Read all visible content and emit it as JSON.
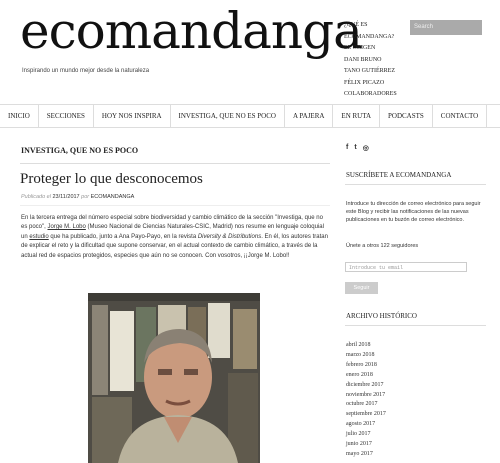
{
  "header": {
    "site_title": "ecomandanga",
    "tagline": "Inspirando un mundo mejor desde la naturaleza",
    "top_links": [
      "¿QUÉ ES ECOMANDANGA?",
      "EL ORIGEN",
      "DANI BRUNO",
      "TANO GUTIÉRREZ",
      "FÉLIX PICAZO",
      "COLABORADORES"
    ],
    "search_placeholder": "Search"
  },
  "nav": {
    "items": [
      "INICIO",
      "SECCIONES",
      "HOY NOS INSPIRA",
      "INVESTIGA, QUE NO ES POCO",
      "A PAJERA",
      "EN RUTA",
      "PODCASTS",
      "CONTACTO"
    ]
  },
  "main": {
    "category_title": "INVESTIGA, QUE NO ES POCO",
    "post": {
      "title": "Proteger lo que desconocemos",
      "published_prefix": "Publicado el",
      "date": "23/11/2017",
      "by": "por",
      "author": "ECOMANDANGA",
      "body_1": "En la tercera entrega del número especial sobre biodiversidad y cambio climático de la sección \"Investiga, que no es poco\",",
      "body_link_1": "Jorge M. Lobo",
      "body_2": "(Museo Nacional de Ciencias Naturales-CSIC, Madrid) nos resume en lenguaje coloquial un",
      "body_link_2": "estudio",
      "body_3": "que ha publicado, junto a Ana Payo-Payo, en la revista",
      "body_journal": "Diversity & Distributions",
      "body_4": ". En él, los autores tratan de explicar el reto y la dificultad que supone conservar, en el actual contexto de cambio climático, a través de la actual red de espacios protegidos, especies que aún no se conocen. Con vosotros, ¡¡Jorge M. Lobo!!"
    }
  },
  "sidebar": {
    "social_icons": [
      "facebook-icon",
      "twitter-icon",
      "instagram-icon"
    ],
    "social_glyphs": [
      "f",
      "t",
      "◎"
    ],
    "subscribe_title": "SUSCRÍBETE A ECOMANDANGA",
    "subscribe_text": "Introduce tu dirección de correo electrónico para seguir este Blog y recibir las notificaciones de las nuevas publicaciones en tu buzón de correo electrónico.",
    "subscribers": "Únete a otros 122 seguidores",
    "email_placeholder": "Introduce tu email",
    "follow_button": "Seguir",
    "archive_title": "ARCHIVO HISTÓRICO",
    "archive": [
      "abril 2018",
      "marzo 2018",
      "febrero 2018",
      "enero 2018",
      "diciembre 2017",
      "noviembre 2017",
      "octubre 2017",
      "septiembre 2017",
      "agosto 2017",
      "julio 2017",
      "junio 2017",
      "mayo 2017"
    ]
  }
}
